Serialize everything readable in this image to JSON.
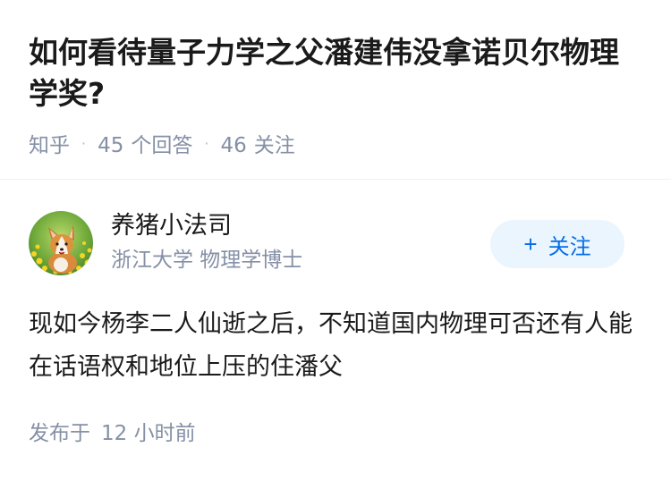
{
  "question": {
    "title": "如何看待量子力学之父潘建伟没拿诺贝尔物理学奖?",
    "source": "知乎",
    "separator": "·",
    "answer_count": "45",
    "answer_label": "个回答",
    "follower_count": "46",
    "follower_label": "关注"
  },
  "answer": {
    "author": {
      "name": "养猪小法司",
      "description": "浙江大学 物理学博士",
      "avatar_icon": "corgi-dog-avatar"
    },
    "follow_button": {
      "plus": "+",
      "label": "关注"
    },
    "content": "现如今杨李二人仙逝之后，不知道国内物理可否还有人能在话语权和地位上压的住潘父",
    "published_label": "发布于",
    "published_time": "12 小时前"
  },
  "colors": {
    "title_text": "#1a1a1a",
    "meta_gray": "#8590a6",
    "follow_bg": "#ebf5fd",
    "follow_text": "#056de8"
  }
}
